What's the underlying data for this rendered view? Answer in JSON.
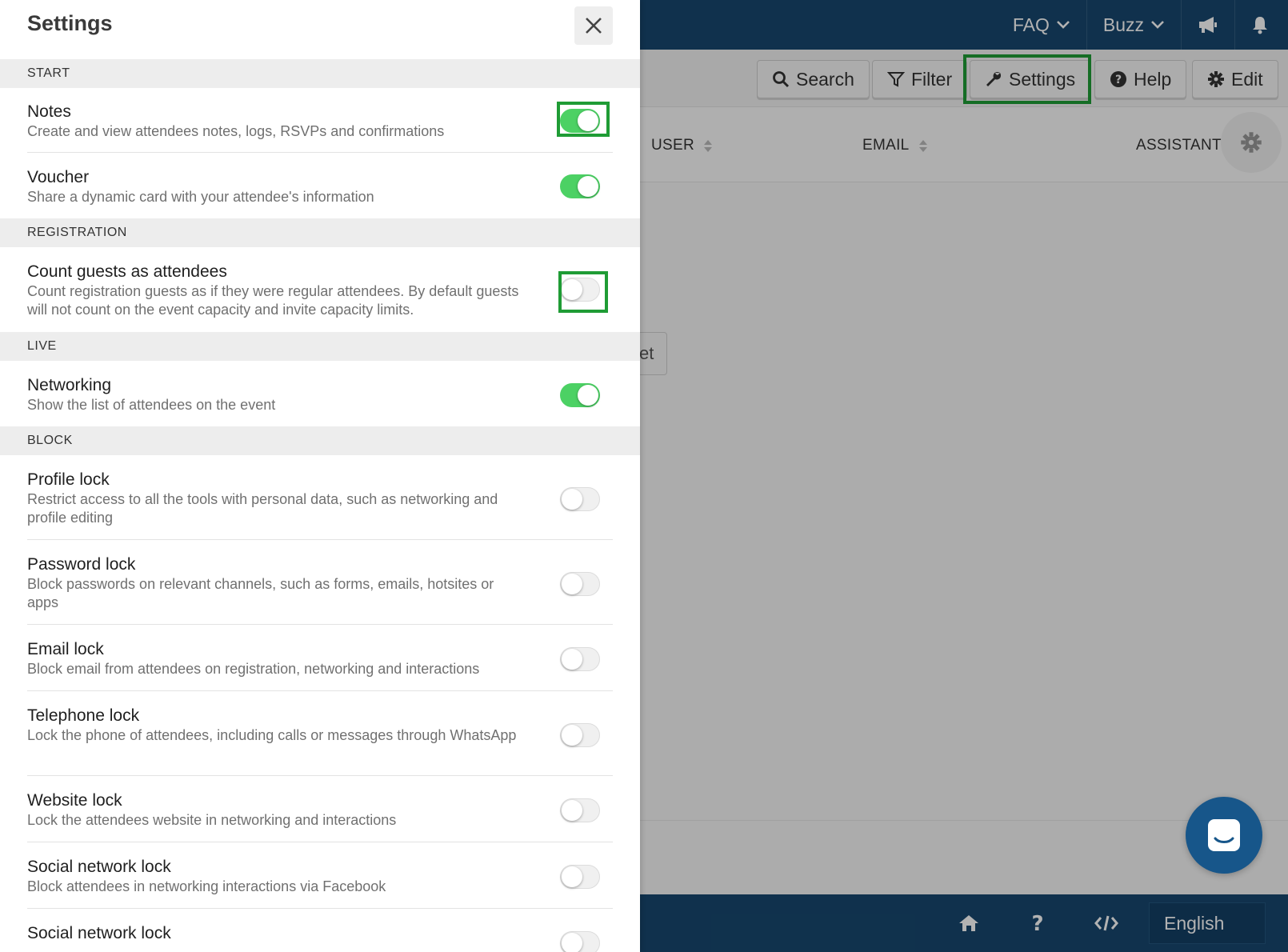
{
  "topnav": {
    "faq_label": "FAQ",
    "buzz_label": "Buzz"
  },
  "toolbar": {
    "search_label": "Search",
    "filter_label": "Filter",
    "settings_label": "Settings",
    "help_label": "Help",
    "edit_label": "Edit"
  },
  "table": {
    "columns": [
      "USER",
      "EMAIL",
      "ASSISTANT"
    ]
  },
  "background": {
    "partial_button_text": "et"
  },
  "footer": {
    "language": "English"
  },
  "colors": {
    "brand": "#17476f",
    "toggle_on": "#4cd164",
    "highlight": "#1f9c35"
  },
  "panel": {
    "title": "Settings",
    "sections": [
      {
        "label": "START",
        "items": [
          {
            "title": "Notes",
            "description": "Create and view attendees notes, logs, RSVPs and confirmations",
            "enabled": true
          },
          {
            "title": "Voucher",
            "description": "Share a dynamic card with your attendee's information",
            "enabled": true
          }
        ]
      },
      {
        "label": "REGISTRATION",
        "items": [
          {
            "title": "Count guests as attendees",
            "description": "Count registration guests as if they were regular attendees. By default guests will not count on the event capacity and invite capacity limits.",
            "enabled": false
          }
        ]
      },
      {
        "label": "LIVE",
        "items": [
          {
            "title": "Networking",
            "description": "Show the list of attendees on the event",
            "enabled": true
          }
        ]
      },
      {
        "label": "BLOCK",
        "items": [
          {
            "title": "Profile lock",
            "description": "Restrict access to all the tools with personal data, such as networking and profile editing",
            "enabled": false
          },
          {
            "title": "Password lock",
            "description": "Block passwords on relevant channels, such as forms, emails, hotsites or apps",
            "enabled": false
          },
          {
            "title": "Email lock",
            "description": "Block email from attendees on registration, networking and interactions",
            "enabled": false
          },
          {
            "title": "Telephone lock",
            "description": "Lock the phone of attendees, including calls or messages through WhatsApp",
            "enabled": false
          },
          {
            "title": "Website lock",
            "description": "Lock the attendees website in networking and interactions",
            "enabled": false
          },
          {
            "title": "Social network lock",
            "description": "Block attendees in networking interactions via Facebook",
            "enabled": false
          },
          {
            "title": "Social network lock",
            "description": "",
            "enabled": false
          }
        ]
      }
    ]
  }
}
